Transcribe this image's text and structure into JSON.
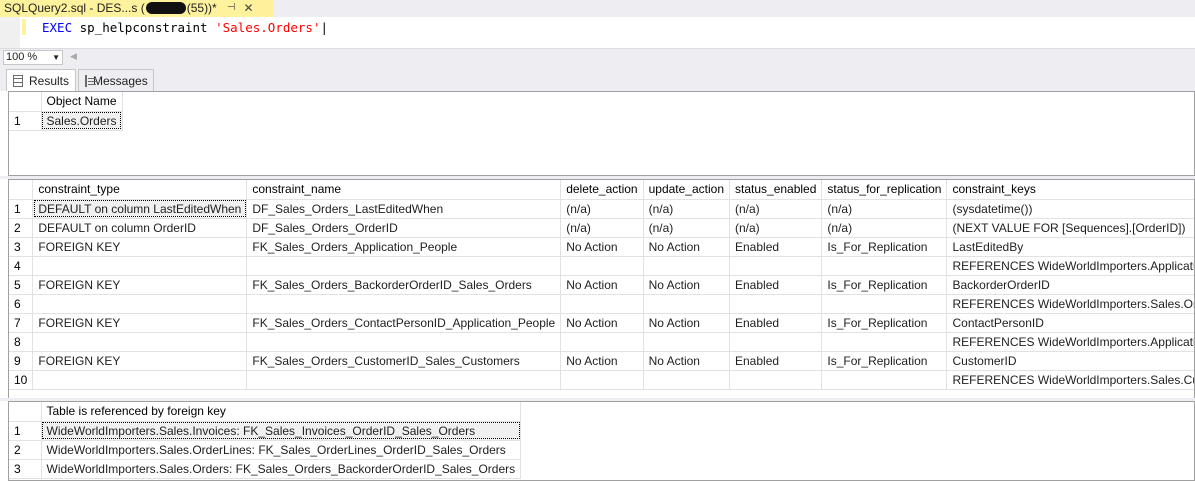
{
  "tab": {
    "title_start": "SQLQuery2.sql - DES...s (",
    "title_end": "(55))*",
    "pin": "⊣",
    "close": "✕"
  },
  "editor": {
    "kw": "EXEC",
    "proc": "sp_helpconstraint",
    "arg": "'Sales.Orders'"
  },
  "zoom": {
    "value": "100 %"
  },
  "result_tabs": {
    "results": "Results",
    "messages": "Messages"
  },
  "grid1": {
    "columns": [
      "Object Name"
    ],
    "rows": [
      {
        "n": "1",
        "cells": [
          "Sales.Orders"
        ]
      }
    ]
  },
  "grid2": {
    "columns": [
      "constraint_type",
      "constraint_name",
      "delete_action",
      "update_action",
      "status_enabled",
      "status_for_replication",
      "constraint_keys"
    ],
    "rows": [
      {
        "n": "1",
        "cells": [
          "DEFAULT on column LastEditedWhen",
          "DF_Sales_Orders_LastEditedWhen",
          "(n/a)",
          "(n/a)",
          "(n/a)",
          "(n/a)",
          "(sysdatetime())"
        ]
      },
      {
        "n": "2",
        "cells": [
          "DEFAULT on column OrderID",
          "DF_Sales_Orders_OrderID",
          "(n/a)",
          "(n/a)",
          "(n/a)",
          "(n/a)",
          "(NEXT VALUE FOR [Sequences].[OrderID])"
        ]
      },
      {
        "n": "3",
        "cells": [
          "FOREIGN KEY",
          "FK_Sales_Orders_Application_People",
          "No Action",
          "No Action",
          "Enabled",
          "Is_For_Replication",
          "LastEditedBy"
        ]
      },
      {
        "n": "4",
        "cells": [
          "",
          "",
          "",
          "",
          "",
          "",
          "REFERENCES WideWorldImporters.Application.People (..."
        ]
      },
      {
        "n": "5",
        "cells": [
          "FOREIGN KEY",
          "FK_Sales_Orders_BackorderOrderID_Sales_Orders",
          "No Action",
          "No Action",
          "Enabled",
          "Is_For_Replication",
          "BackorderOrderID"
        ]
      },
      {
        "n": "6",
        "cells": [
          "",
          "",
          "",
          "",
          "",
          "",
          "REFERENCES WideWorldImporters.Sales.Orders (Order"
        ]
      },
      {
        "n": "7",
        "cells": [
          "FOREIGN KEY",
          "FK_Sales_Orders_ContactPersonID_Application_People",
          "No Action",
          "No Action",
          "Enabled",
          "Is_For_Replication",
          "ContactPersonID"
        ]
      },
      {
        "n": "8",
        "cells": [
          "",
          "",
          "",
          "",
          "",
          "",
          "REFERENCES WideWorldImporters.Application.People (..."
        ]
      },
      {
        "n": "9",
        "cells": [
          "FOREIGN KEY",
          "FK_Sales_Orders_CustomerID_Sales_Customers",
          "No Action",
          "No Action",
          "Enabled",
          "Is_For_Replication",
          "CustomerID"
        ]
      },
      {
        "n": "10",
        "cells": [
          "",
          "",
          "",
          "",
          "",
          "",
          "REFERENCES WideWorldImporters.Sales.Customers (C..."
        ]
      }
    ]
  },
  "grid3": {
    "columns": [
      "Table is referenced by foreign key"
    ],
    "rows": [
      {
        "n": "1",
        "cells": [
          "WideWorldImporters.Sales.Invoices: FK_Sales_Invoices_OrderID_Sales_Orders"
        ]
      },
      {
        "n": "2",
        "cells": [
          "WideWorldImporters.Sales.OrderLines: FK_Sales_OrderLines_OrderID_Sales_Orders"
        ]
      },
      {
        "n": "3",
        "cells": [
          "WideWorldImporters.Sales.Orders: FK_Sales_Orders_BackorderOrderID_Sales_Orders"
        ]
      }
    ]
  }
}
